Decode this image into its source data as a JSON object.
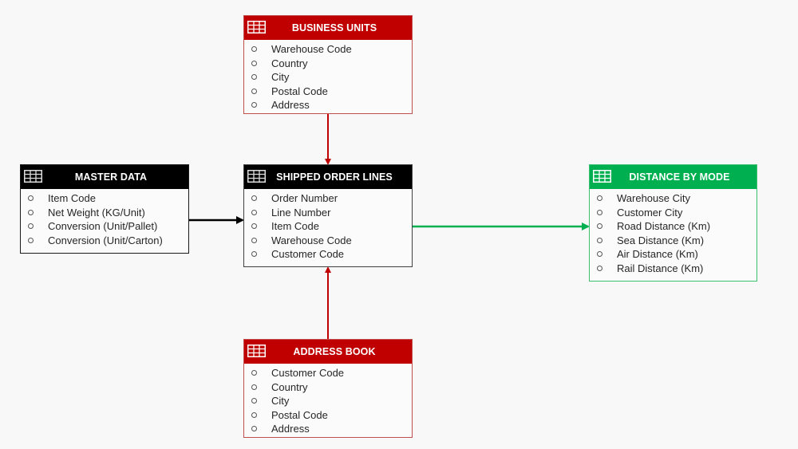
{
  "colors": {
    "red": "#C00000",
    "black": "#000000",
    "green": "#00B050",
    "background": "#F8F8F8"
  },
  "entities": {
    "business_units": {
      "title": "BUSINESS UNITS",
      "icon": "table-icon",
      "color": "#C00000",
      "fields": [
        "Warehouse Code",
        "Country",
        "City",
        "Postal Code",
        "Address"
      ]
    },
    "master_data": {
      "title": "MASTER DATA",
      "icon": "table-icon",
      "color": "#000000",
      "fields": [
        "Item Code",
        "Net Weight (KG/Unit)",
        "Conversion (Unit/Pallet)",
        "Conversion (Unit/Carton)"
      ]
    },
    "shipped_order_lines": {
      "title": "SHIPPED ORDER LINES",
      "icon": "table-icon",
      "color": "#000000",
      "fields": [
        "Order Number",
        "Line Number",
        "Item Code",
        "Warehouse Code",
        "Customer Code"
      ]
    },
    "distance_by_mode": {
      "title": "DISTANCE BY MODE",
      "icon": "table-icon",
      "color": "#00B050",
      "fields": [
        "Warehouse City",
        "Customer City",
        "Road Distance (Km)",
        "Sea Distance (Km)",
        "Air Distance (Km)",
        "Rail Distance (Km)"
      ]
    },
    "address_book": {
      "title": "ADDRESS BOOK",
      "icon": "table-icon",
      "color": "#C00000",
      "fields": [
        "Customer Code",
        "Country",
        "City",
        "Postal Code",
        "Address"
      ]
    }
  },
  "connections": [
    {
      "from": "business_units",
      "to": "shipped_order_lines",
      "color": "#C00000"
    },
    {
      "from": "master_data",
      "to": "shipped_order_lines",
      "color": "#000000"
    },
    {
      "from": "shipped_order_lines",
      "to": "distance_by_mode",
      "color": "#00B050"
    },
    {
      "from": "address_book",
      "to": "shipped_order_lines",
      "color": "#C00000"
    }
  ]
}
